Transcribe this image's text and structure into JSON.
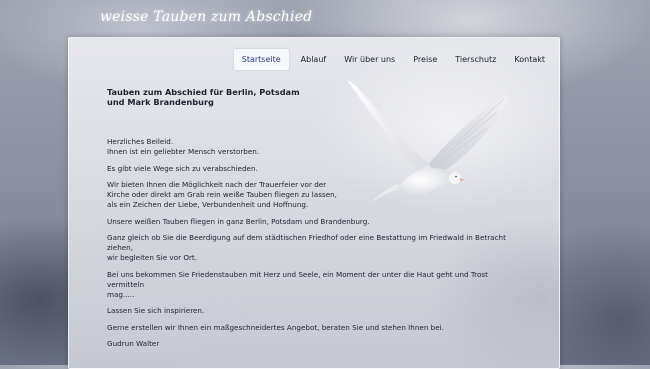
{
  "site": {
    "title": "weisse Tauben zum Abschied"
  },
  "nav": {
    "items": [
      {
        "label": "Startseite",
        "active": true
      },
      {
        "label": "Ablauf"
      },
      {
        "label": "Wir über uns"
      },
      {
        "label": "Preise"
      },
      {
        "label": "Tierschutz"
      },
      {
        "label": "Kontakt"
      }
    ]
  },
  "main": {
    "heading": "Tauben zum Abschied für Berlin, Potsdam und Mark Brandenburg",
    "paragraphs": [
      {
        "lines": [
          "Herzliches Beileid.",
          "Ihnen ist ein geliebter Mensch verstorben."
        ]
      },
      {
        "lines": [
          "Es gibt viele Wege sich zu verabschieden."
        ]
      },
      {
        "lines": [
          "Wir bieten Ihnen die Möglichkeit nach der Trauerfeier vor der",
          "Kirche oder direkt am Grab rein weiße Tauben fliegen zu lassen,",
          "als ein Zeichen der Liebe, Verbundenheit und Hoffnung."
        ]
      },
      {
        "lines": [
          "Unsere weißen Tauben fliegen in ganz Berlin, Potsdam und Brandenburg."
        ]
      },
      {
        "lines": [
          "Ganz gleich ob Sie die Beerdigung auf dem städtischen Friedhof oder eine Bestattung im Friedwald in Betracht ziehen,",
          "wir begleiten Sie vor Ort."
        ]
      },
      {
        "lines": [
          "Bei uns bekommen Sie Friedenstauben mit Herz und Seele, ein Moment der unter die Haut geht und Trost vermitteln",
          "mag....."
        ]
      },
      {
        "lines": [
          "Lassen Sie sich inspirieren."
        ]
      },
      {
        "lines": [
          "Gerne erstellen wir Ihnen ein maßgeschneidertes Angebot, beraten Sie und stehen Ihnen bei."
        ]
      },
      {
        "lines": [
          "Gudrun Walter"
        ]
      }
    ]
  },
  "images": {
    "hero": "white-dove-in-flight"
  }
}
